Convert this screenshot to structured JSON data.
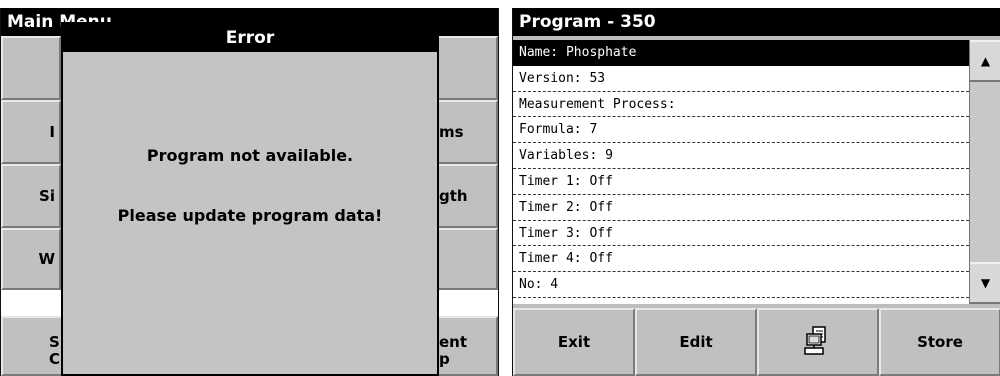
{
  "left": {
    "title": "Main Menu",
    "left_buttons": [
      "",
      "I",
      "Si",
      "W"
    ],
    "right_buttons": [
      "",
      "ms",
      "gth",
      ""
    ],
    "bottom_left": "S\nC",
    "bottom_right": "ent\np",
    "dialog": {
      "title": "Error",
      "line1": "Program not available.",
      "line2": "Please update program data!"
    }
  },
  "right": {
    "title": "Program - 350",
    "rows": [
      "Name: Phosphate",
      "Version: 53",
      "Measurement Process:",
      "Formula: 7",
      "Variables: 9",
      "Timer 1: Off",
      "Timer 2: Off",
      "Timer 3: Off",
      "Timer 4: Off",
      "No: 4"
    ],
    "selected_row": 0,
    "scroll_up_icon": "▲",
    "scroll_down_icon": "▼",
    "buttons": {
      "exit": "Exit",
      "edit": "Edit",
      "pc_icon": "computer-transfer-icon",
      "store": "Store"
    }
  }
}
